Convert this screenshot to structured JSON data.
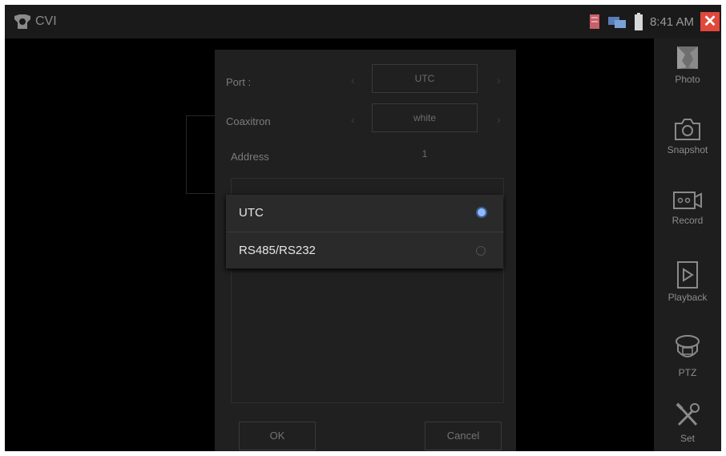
{
  "app": {
    "title": "CVI"
  },
  "status": {
    "time": "8:41 AM",
    "close": "✕"
  },
  "dialog": {
    "rows": [
      {
        "label": "Port :",
        "value": "UTC"
      },
      {
        "label": "Coaxitron",
        "value": "white"
      },
      {
        "label": "Address",
        "value": "1"
      }
    ],
    "ok_label": "OK",
    "cancel_label": "Cancel"
  },
  "popup": {
    "options": [
      {
        "label": "UTC",
        "selected": true
      },
      {
        "label": "RS485/RS232",
        "selected": false
      }
    ]
  },
  "sidebar": {
    "items": [
      {
        "label": "Photo",
        "icon": "photo-icon"
      },
      {
        "label": "Snapshot",
        "icon": "camera-icon"
      },
      {
        "label": "Record",
        "icon": "record-icon"
      },
      {
        "label": "Playback",
        "icon": "playback-icon"
      },
      {
        "label": "PTZ",
        "icon": "ptz-icon"
      },
      {
        "label": "Set",
        "icon": "tools-icon"
      }
    ]
  },
  "colors": {
    "accent_radio": "#8fb8ff",
    "close_button": "#e0483c"
  }
}
